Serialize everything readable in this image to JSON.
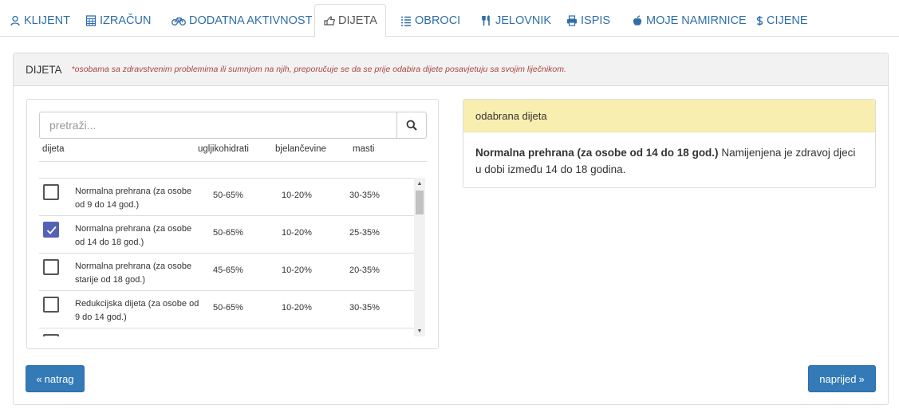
{
  "tabs": [
    {
      "label": "KLIJENT",
      "icon": "user-icon"
    },
    {
      "label": "IZRAČUN",
      "icon": "calculator-icon"
    },
    {
      "label": "DODATNA AKTIVNOST",
      "icon": "bicycle-icon"
    },
    {
      "label": "DIJETA",
      "icon": "hand-pointer-icon",
      "active": true
    },
    {
      "label": "OBROCI",
      "icon": "list-icon"
    },
    {
      "label": "JELOVNIK",
      "icon": "cutlery-icon"
    },
    {
      "label": "ISPIS",
      "icon": "print-icon"
    },
    {
      "label": "MOJE NAMIRNICE",
      "icon": "apple-icon"
    },
    {
      "label": "CIJENE",
      "icon": "dollar-icon"
    }
  ],
  "panel": {
    "title": "DIJETA",
    "note": "*osobama sa zdravstvenim problemima ili sumnjom na njih, preporučuje se da se prije odabira dijete posavjetuju sa svojim liječnikom."
  },
  "search": {
    "placeholder": "pretraži...",
    "value": ""
  },
  "columns": {
    "diet": "dijeta",
    "carbs": "ugljikohidrati",
    "protein": "bjelančevine",
    "fat": "masti"
  },
  "diets": [
    {
      "name": "Normalna prehrana (za osobe od 9 do 14 god.)",
      "carbs": "50-65%",
      "protein": "10-20%",
      "fat": "30-35%",
      "checked": false
    },
    {
      "name": "Normalna prehrana (za osobe od 14 do 18 god.)",
      "carbs": "50-65%",
      "protein": "10-20%",
      "fat": "25-35%",
      "checked": true
    },
    {
      "name": "Normalna prehrana (za osobe starije od 18 god.)",
      "carbs": "45-65%",
      "protein": "10-20%",
      "fat": "20-35%",
      "checked": false
    },
    {
      "name": "Redukcijska dijeta (za osobe od 9 do 14 god.)",
      "carbs": "50-65%",
      "protein": "10-20%",
      "fat": "30-35%",
      "checked": false
    },
    {
      "name": "",
      "carbs": "",
      "protein": "",
      "fat": "",
      "checked": false
    }
  ],
  "selected": {
    "header": "odabrana dijeta",
    "name": "Normalna prehrana (za osobe od 14 do 18 god.)",
    "description": "Namijenjena je zdravoj djeci u dobi između 14 do 18 godina."
  },
  "buttons": {
    "back": "natrag",
    "next": "naprijed"
  },
  "colors": {
    "link": "#2f6ea9",
    "primary": "#337ab7",
    "checkbox": "#5461b5",
    "note": "#a94442",
    "selected_header": "#f8eeb0"
  }
}
